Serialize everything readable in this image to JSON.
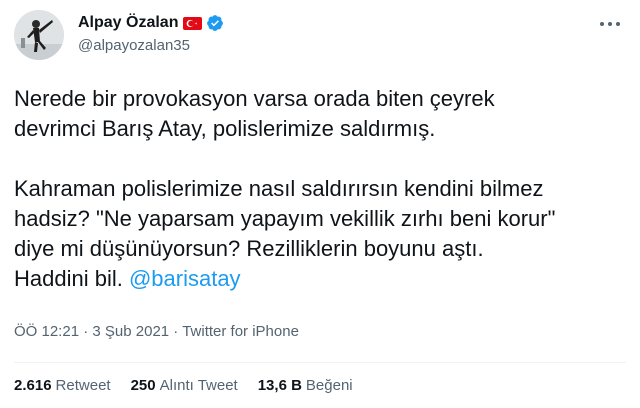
{
  "author": {
    "display_name": "Alpay Özalan",
    "handle": "@alpayozalan35"
  },
  "tweet": {
    "line1": "Nerede bir provokasyon varsa orada biten çeyrek\ndevrimci Barış Atay, polislerimize saldırmış.",
    "line2": "Kahraman polislerimize nasıl saldırırsın kendini bilmez\nhadsiz? \"Ne yaparsam yapayım vekillik zırhı beni korur\"\ndiye mi düşünüyorsun? Rezilliklerin boyunu aştı.\nHaddini bil. ",
    "mention": "@barisatay"
  },
  "meta": {
    "time": "ÖÖ 12:21",
    "sep1": " · ",
    "date": "3 Şub 2021",
    "sep2": " · ",
    "source": "Twitter for iPhone"
  },
  "stats": {
    "retweets_count": "2.616",
    "retweets_label": "Retweet",
    "quotes_count": "250",
    "quotes_label": "Alıntı Tweet",
    "likes_count": "13,6 B",
    "likes_label": "Beğeni"
  },
  "colors": {
    "link": "#1d9bf0",
    "secondary_text": "#536471",
    "verified": "#1d9bf0",
    "flag_red": "#e30a17"
  },
  "icons": {
    "flag": "turkey-flag-icon",
    "verified": "verified-badge-icon",
    "more": "more-options-icon"
  }
}
